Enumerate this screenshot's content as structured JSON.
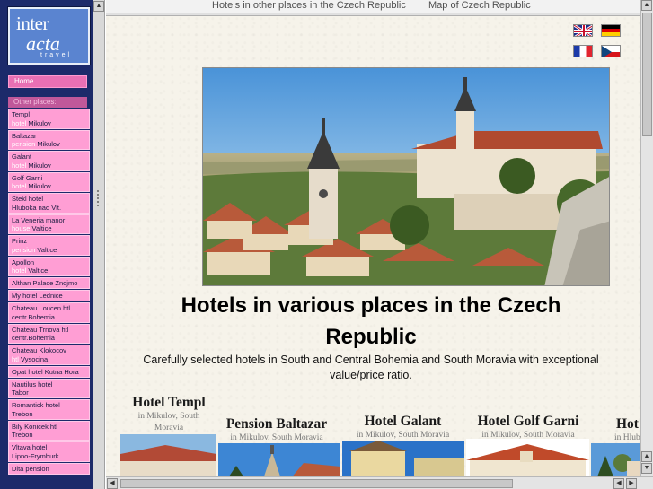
{
  "logo": {
    "line1": "inter",
    "line2": "acta",
    "line3": "travel"
  },
  "nav": {
    "home": "Home",
    "other_places": "Other places:",
    "items": [
      {
        "l1": "Templ",
        "l2a": "hotel ",
        "l2b": "Mikulov"
      },
      {
        "l1": "Baltazar",
        "l2a": "pension ",
        "l2b": "Mikulov"
      },
      {
        "l1": "Galant",
        "l2a": "hotel ",
        "l2b": "Mikulov"
      },
      {
        "l1": "Golf Garni",
        "l2a": "hotel ",
        "l2b": "Mikulov"
      },
      {
        "l1": "Stekl hotel",
        "l2a": "",
        "l2b": "Hluboka nad Vlt."
      },
      {
        "l1": "La Veneria manor",
        "l2a": "house ",
        "l2b": "Valtice"
      },
      {
        "l1": "Prinz",
        "l2a": "pension ",
        "l2b": "Valtice"
      },
      {
        "l1": "Apollon",
        "l2a": "hotel ",
        "l2b": "Valtice"
      },
      {
        "l1": "Althan Palace Znojmo",
        "l2a": "",
        "l2b": ""
      },
      {
        "l1": "My hotel Lednice",
        "l2a": "",
        "l2b": ""
      },
      {
        "l1": "Chateau Loucen htl",
        "l2a": "",
        "l2b": "centr.Bohemia"
      },
      {
        "l1": "Chateau Trnova htl",
        "l2a": "",
        "l2b": "centr.Bohemia"
      },
      {
        "l1": "Chateau Klokocov",
        "l2a": "htl ",
        "l2b": "Vysocina"
      },
      {
        "l1": "Opat hotel Kutna Hora",
        "l2a": "",
        "l2b": ""
      },
      {
        "l1": "Nautilus hotel",
        "l2a": "",
        "l2b": "Tabor"
      },
      {
        "l1": "Romantick hotel",
        "l2a": "",
        "l2b": "Trebon"
      },
      {
        "l1": "Bily Konicek htl",
        "l2a": "",
        "l2b": "Trebon"
      },
      {
        "l1": "Vltava hotel",
        "l2a": "",
        "l2b": "Lipno-Frymburk"
      },
      {
        "l1": "Dita pension",
        "l2a": "",
        "l2b": ""
      }
    ]
  },
  "topbar": {
    "link1": "Hotels in other places in the Czech Republic",
    "link2": "Map of Czech Republic"
  },
  "languages": [
    "english-flag",
    "german-flag",
    "french-flag",
    "czech-flag"
  ],
  "main": {
    "title": "Hotels in various places in the Czech Republic",
    "subtitle": "Carefully selected hotels in South and Central Bohemia and South Moravia with exceptional value/price ratio."
  },
  "hotels": [
    {
      "name": "Hotel Templ",
      "location": "in Mikulov, South Moravia"
    },
    {
      "name": "Pension Baltazar",
      "location": "in Mikulov, South Moravia"
    },
    {
      "name": "Hotel Galant",
      "location": "in Mikulov, South Moravia"
    },
    {
      "name": "Hotel Golf Garni",
      "location": "in Mikulov, South Moravia"
    },
    {
      "name": "Hot",
      "location": "in Hlubo"
    }
  ],
  "colors": {
    "sidebar": "#1c2a6a",
    "nav_item": "#ff9ed4",
    "nav_home": "#e870b4",
    "page_bg": "#f6f3ea"
  }
}
